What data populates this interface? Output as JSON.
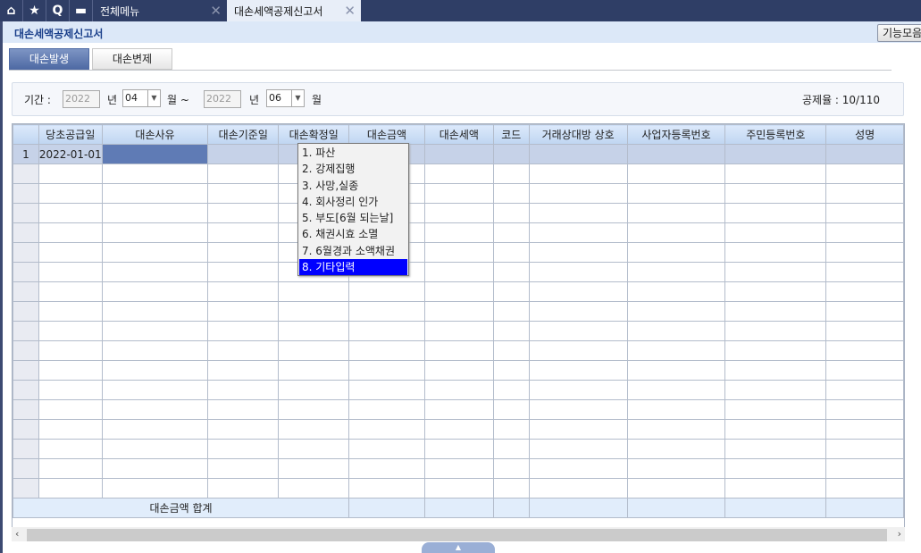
{
  "topbar": {
    "icons": [
      "home-icon",
      "star-icon",
      "search-icon",
      "menu-grid-icon"
    ],
    "tabs": [
      {
        "label": "전체메뉴"
      },
      {
        "label": "대손세액공제신고서",
        "active": true
      }
    ],
    "close_glyph": "✕"
  },
  "page": {
    "title": "대손세액공제신고서",
    "function_button": "기능모음"
  },
  "subtabs": [
    {
      "label": "대손발생",
      "active": true
    },
    {
      "label": "대손변제"
    }
  ],
  "filter": {
    "period_label": "기간 :",
    "from_year": "2022",
    "year_unit": "년",
    "from_month": "04",
    "month_unit_tilde": "월 ~",
    "to_year": "2022",
    "to_month": "06",
    "month_unit": "월",
    "rate_label": "공제율 : 10/110"
  },
  "grid": {
    "columns": [
      "",
      "당초공급일",
      "대손사유",
      "대손기준일",
      "대손확정일",
      "대손금액",
      "대손세액",
      "코드",
      "거래상대방 상호",
      "사업자등록번호",
      "주민등록번호",
      "성명"
    ],
    "rows": [
      {
        "num": "1",
        "supply_date": "2022-01-01"
      }
    ],
    "empty_rows": 17,
    "total_label": "대손금액 합계"
  },
  "reason_dropdown": {
    "options": [
      "1. 파산",
      "2. 강제집행",
      "3. 사망,실종",
      "4. 회사정리 인가",
      "5. 부도[6월 되는날]",
      "6. 채권시효 소멸",
      "7. 6월경과 소액채권",
      "8. 기타입력"
    ],
    "highlighted_index": 7,
    "highlight_color": "#0000ff"
  }
}
